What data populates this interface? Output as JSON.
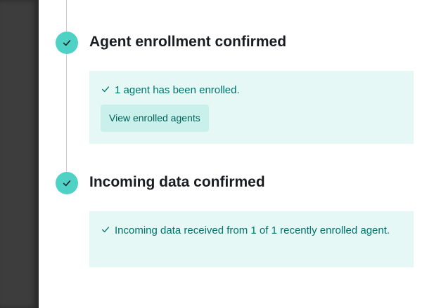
{
  "steps": [
    {
      "title": "Agent enrollment confirmed",
      "status_icon": "check-icon",
      "message": "1 agent has been enrolled.",
      "button_label": "View enrolled agents"
    },
    {
      "title": "Incoming data confirmed",
      "status_icon": "check-icon",
      "message": "Incoming data received from 1 of 1 recently enrolled agent."
    }
  ],
  "colors": {
    "step_complete": "#4fd1c5",
    "callout_bg": "#e6f8f5",
    "callout_text": "#00726b"
  }
}
